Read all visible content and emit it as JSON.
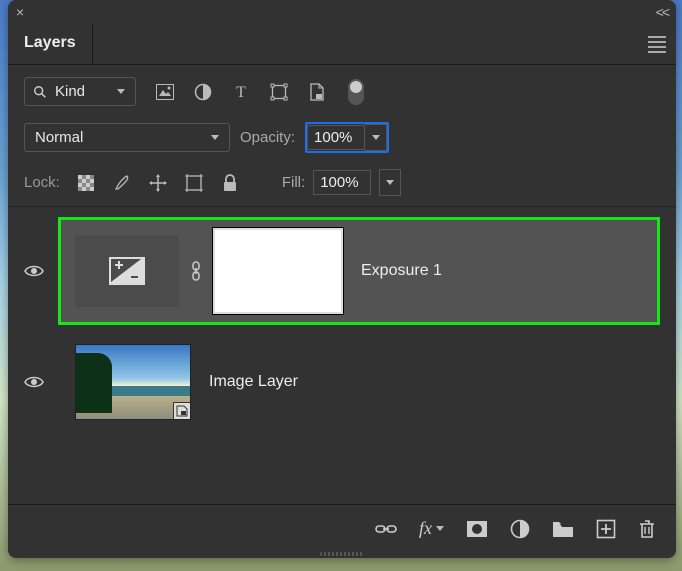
{
  "panel": {
    "title": "Layers"
  },
  "kind": {
    "label": "Kind"
  },
  "blend": {
    "mode": "Normal",
    "opacity_label": "Opacity:",
    "opacity_value": "100%"
  },
  "lock": {
    "label": "Lock:",
    "fill_label": "Fill:",
    "fill_value": "100%"
  },
  "layers": [
    {
      "name": "Exposure 1"
    },
    {
      "name": "Image Layer"
    }
  ]
}
